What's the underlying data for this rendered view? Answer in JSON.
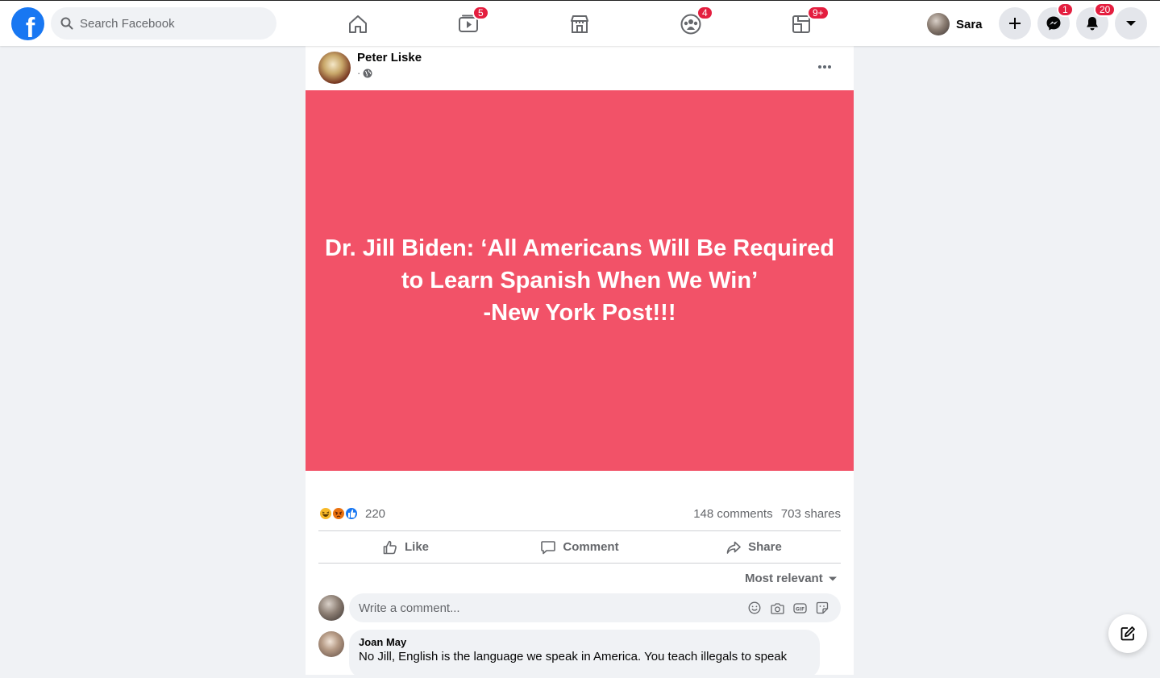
{
  "header": {
    "logo_letter": "f",
    "search_placeholder": "Search Facebook",
    "nav": {
      "home_icon": "home-icon",
      "watch_badge": "5",
      "marketplace_icon": "marketplace-icon",
      "groups_badge": "4",
      "gaming_badge": "9+"
    },
    "profile_name": "Sara",
    "messenger_badge": "1",
    "notifications_badge": "20"
  },
  "post": {
    "author": "Peter Liske",
    "meta_separator": "·",
    "banner_lines": [
      "Dr. Jill Biden: ‘All Americans Will Be Required",
      "to Learn Spanish When We Win’",
      "-New York Post!!!"
    ],
    "banner_color": "#f25268",
    "reactions": [
      "haha",
      "angry",
      "like"
    ],
    "reaction_count": "220",
    "comments_count": "148 comments",
    "shares_count": "703 shares",
    "actions": {
      "like": "Like",
      "comment": "Comment",
      "share": "Share"
    },
    "sort_label": "Most relevant",
    "comment_placeholder": "Write a comment...",
    "comments": [
      {
        "name": "Joan May",
        "text": "No Jill, English is the language we speak in America. You teach illegals to speak"
      }
    ]
  },
  "colors": {
    "brand": "#1877f2",
    "badge": "#e41e3f",
    "page_bg": "#f0f2f5"
  }
}
